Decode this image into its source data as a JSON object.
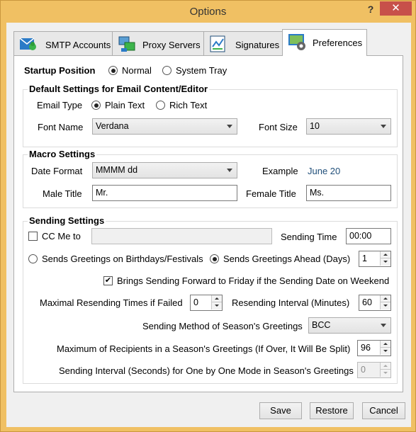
{
  "window": {
    "title": "Options",
    "help": "?",
    "close": "✕"
  },
  "tabs": [
    {
      "label": "SMTP Accounts",
      "icon": "smtp-accounts-icon"
    },
    {
      "label": "Proxy Servers",
      "icon": "proxy-servers-icon"
    },
    {
      "label": "Signatures",
      "icon": "signatures-icon"
    },
    {
      "label": "Preferences",
      "icon": "preferences-icon",
      "active": true
    }
  ],
  "startup": {
    "label": "Startup Position",
    "normal": "Normal",
    "tray": "System Tray",
    "selected": "Normal"
  },
  "defaults": {
    "title": "Default Settings for Email Content/Editor",
    "email_type_label": "Email Type",
    "plain": "Plain Text",
    "rich": "Rich Text",
    "selected": "Plain Text",
    "font_name_label": "Font Name",
    "font_name_value": "Verdana",
    "font_size_label": "Font Size",
    "font_size_value": "10"
  },
  "macro": {
    "title": "Macro Settings",
    "date_format_label": "Date Format",
    "date_format_value": "MMMM dd",
    "example_label": "Example",
    "example_value": "June 20",
    "male_label": "Male Title",
    "male_value": "Mr.",
    "female_label": "Female Title",
    "female_value": "Ms."
  },
  "sending": {
    "title": "Sending Settings",
    "cc_label": "CC Me to",
    "cc_checked": false,
    "cc_value": "",
    "sending_time_label": "Sending Time",
    "sending_time_value": "00:00",
    "on_birthdays": "Sends Greetings on Birthdays/Festivals",
    "ahead": "Sends Greetings Ahead (Days)",
    "ahead_value": "1",
    "selected": "Sends Greetings Ahead (Days)",
    "friday_label": "Brings Sending Forward to Friday if the Sending Date on Weekend",
    "friday_checked": true,
    "max_resend_label": "Maximal Resending Times if Failed",
    "max_resend_value": "0",
    "resend_interval_label": "Resending Interval (Minutes)",
    "resend_interval_value": "60",
    "method_label": "Sending Method of Season's Greetings",
    "method_value": "BCC",
    "max_recipients_label": "Maximum of Recipients in a Season's Greetings (If Over, It Will Be Split)",
    "max_recipients_value": "96",
    "interval_label": "Sending Interval (Seconds) for One by One Mode in Season's Greetings",
    "interval_value": "0"
  },
  "buttons": {
    "save": "Save",
    "restore": "Restore",
    "cancel": "Cancel"
  }
}
